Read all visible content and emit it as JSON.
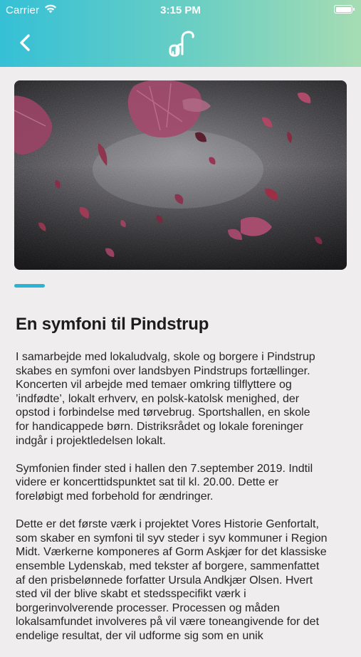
{
  "status_bar": {
    "carrier": "Carrier",
    "time": "3:15 PM"
  },
  "nav": {
    "back_icon": "chevron-left-icon",
    "logo_icon": "app-logo-icon"
  },
  "colors": {
    "header_gradient_start": "#35c0d6",
    "header_gradient_end": "#a6dcb3",
    "indicator": "#2ab4d4",
    "background": "#efeded"
  },
  "article": {
    "title": "En symfoni til Pindstrup",
    "paragraphs": [
      [
        "I samarbejde med lokaludvalg, skole og borgere i Pindstrup",
        "skabes en symfoni over landsbyen Pindstrups fortællinger.",
        "Koncerten vil arbejde med temaer omkring tilflyttere og",
        "’indfødte’, lokalt erhverv, en polsk-katolsk menighed, der",
        "opstod i forbindelse med tørvebrug. Sportshallen, en skole",
        "for handicappede børn. Distriksrådet og lokale foreninger",
        "indgår i projektledelsen lokalt."
      ],
      [
        "Symfonien finder sted i hallen den 7.september 2019. Indtil",
        "videre er koncerttidspunktet sat til kl. 20.00. Dette er",
        "foreløbigt med forbehold for ændringer."
      ],
      [
        "Dette er det første værk i projektet Vores Historie Genfortalt,",
        "som skaber en symfoni til syv steder i syv kommuner i Region",
        "Midt. Værkerne komponeres af Gorm Askjær for det klassiske",
        "ensemble Lydenskab, med tekster af borgere, sammenfattet",
        "af den prisbelønnede forfatter Ursula Andkjær Olsen. Hvert",
        "sted vil der blive skabt et stedsspecifikt værk i",
        "borgerinvolverende processer. Processen og måden",
        "lokalsamfundet involveres på vil være toneangivende for det",
        "endelige resultat, der vil udforme sig som en unik"
      ]
    ]
  }
}
